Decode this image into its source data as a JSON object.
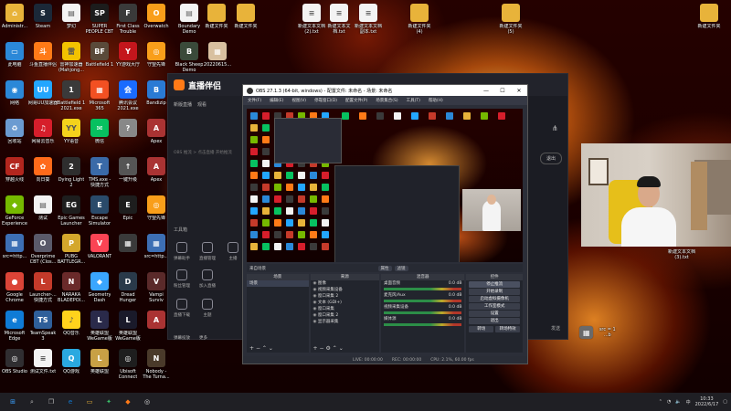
{
  "desktop": {
    "columns": [
      [
        {
          "label": "Administr...",
          "icon": "user-folder-icon",
          "color": "#e8b33a",
          "glyph": "⌂"
        },
        {
          "label": "此电脑",
          "icon": "this-pc-icon",
          "color": "#2b88d8",
          "glyph": "▭"
        },
        {
          "label": "网络",
          "icon": "network-icon",
          "color": "#2b88d8",
          "glyph": "◉"
        },
        {
          "label": "回收站",
          "icon": "recycle-bin-icon",
          "color": "#6b9bd1",
          "glyph": "♻"
        },
        {
          "label": "穿越火线",
          "icon": "crossfire-icon",
          "color": "#b3261e",
          "glyph": "CF"
        },
        {
          "label": "GeForce\nExperience",
          "icon": "geforce-icon",
          "color": "#76b900",
          "glyph": "◆"
        },
        {
          "label": "src=http...",
          "icon": "image-file-icon",
          "color": "#3d6fb4",
          "glyph": "▦"
        },
        {
          "label": "Google\nChrome",
          "icon": "chrome-icon",
          "color": "#db4437",
          "glyph": "●"
        },
        {
          "label": "Microsoft\nEdge",
          "icon": "edge-icon",
          "color": "#0f7bd6",
          "glyph": "e"
        },
        {
          "label": "OBS Studio",
          "icon": "obs-icon",
          "color": "#302e31",
          "glyph": "◎"
        }
      ],
      [
        {
          "label": "Steam",
          "icon": "steam-icon",
          "color": "#1b2838",
          "glyph": "S"
        },
        {
          "label": "斗鱼直播伴侣",
          "icon": "douyu-icon",
          "color": "#ff7a17",
          "glyph": "斗"
        },
        {
          "label": "网易UU加速器",
          "icon": "uu-booster-icon",
          "color": "#23a6ff",
          "glyph": "UU"
        },
        {
          "label": "网易云音乐",
          "icon": "netease-music-icon",
          "color": "#d61e2b",
          "glyph": "♫"
        },
        {
          "label": "向日葵",
          "icon": "sunlogin-icon",
          "color": "#ff6a1a",
          "glyph": "✿"
        },
        {
          "label": "测试",
          "icon": "test-file-icon",
          "color": "#f3f3f3",
          "glyph": "▤"
        },
        {
          "label": "Overprime\nCBT (Clos...",
          "icon": "overprime-icon",
          "color": "#5a5a6a",
          "glyph": "O"
        },
        {
          "label": "Launcher-...\n快捷方式",
          "icon": "launcher-icon",
          "color": "#c53a2a",
          "glyph": "L"
        },
        {
          "label": "TeamSpeak\n3",
          "icon": "teamspeak-icon",
          "color": "#2f5f9a",
          "glyph": "TS"
        },
        {
          "label": "测试文件.txt",
          "icon": "text-file-icon",
          "color": "#f3f3f3",
          "glyph": "≡"
        }
      ],
      [
        {
          "label": "梦幻",
          "icon": "file-icon",
          "color": "#f3f3f3",
          "glyph": "▤"
        },
        {
          "label": "雷神加速器\n(Mahjong...",
          "icon": "leishen-icon",
          "color": "#f2c200",
          "glyph": "雷"
        },
        {
          "label": "Battlefield 1\n2021.exe",
          "icon": "battlefield-icon",
          "color": "#3a3a3a",
          "glyph": "1"
        },
        {
          "label": "YY语音",
          "icon": "yy-icon",
          "color": "#f4d21c",
          "glyph": "YY"
        },
        {
          "label": "Dying Light\n2",
          "icon": "dying-light-icon",
          "color": "#2e2e2e",
          "glyph": "2"
        },
        {
          "label": "Epic Games\nLauncher",
          "icon": "epic-games-icon",
          "color": "#1e1e1e",
          "glyph": "EG"
        },
        {
          "label": "PUBG\nBATTLEGR...",
          "icon": "pubg-icon",
          "color": "#d4a72c",
          "glyph": "P"
        },
        {
          "label": "NARAKA\nBLADEPOI...",
          "icon": "naraka-icon",
          "color": "#6a2a2a",
          "glyph": "N"
        },
        {
          "label": "QQ音乐",
          "icon": "qq-music-icon",
          "color": "#ffd21c",
          "glyph": "♪"
        },
        {
          "label": "QQ游戏",
          "icon": "qq-game-icon",
          "color": "#2aa9e0",
          "glyph": "Q"
        }
      ],
      [
        {
          "label": "SUPER\nPEOPLE CBT",
          "icon": "super-people-icon",
          "color": "#1c1c1c",
          "glyph": "SP"
        },
        {
          "label": "Battlefield 1",
          "icon": "battlefield-1-icon",
          "color": "#5a4a3a",
          "glyph": "BF"
        },
        {
          "label": "Microsoft\n365",
          "icon": "microsoft-365-icon",
          "color": "#f25022",
          "glyph": "▦"
        },
        {
          "label": "微信",
          "icon": "wechat-icon",
          "color": "#07c160",
          "glyph": "✉"
        },
        {
          "label": "TMS.exe -\n快捷方式",
          "icon": "tms-icon",
          "color": "#3a6aa8",
          "glyph": "T"
        },
        {
          "label": "Escape\nSimulator",
          "icon": "escape-simulator-icon",
          "color": "#2a4a6a",
          "glyph": "E"
        },
        {
          "label": "VALORANT",
          "icon": "valorant-icon",
          "color": "#fa4454",
          "glyph": "V"
        },
        {
          "label": "Geometry\nDash",
          "icon": "geometry-dash-icon",
          "color": "#3aa6ff",
          "glyph": "◆"
        },
        {
          "label": "英雄联盟\nWeGame版",
          "icon": "lol-wegame-icon",
          "color": "#2a2a4a",
          "glyph": "L"
        },
        {
          "label": "英雄联盟",
          "icon": "lol-icon",
          "color": "#c8a045",
          "glyph": "L"
        }
      ],
      [
        {
          "label": "First Class\nTrouble",
          "icon": "first-class-trouble-icon",
          "color": "#3a3a3a",
          "glyph": "F"
        },
        {
          "label": "YY游戏大厅",
          "icon": "yy-game-icon",
          "color": "#c4161c",
          "glyph": "Y"
        },
        {
          "label": "腾讯会议\n2021.exe",
          "icon": "tencent-meeting-icon",
          "color": "#1a6bff",
          "glyph": "会"
        },
        {
          "label": "",
          "icon": "app-icon",
          "color": "#888888",
          "glyph": "?"
        },
        {
          "label": "一键升级",
          "icon": "app-icon",
          "color": "#555555",
          "glyph": "↑"
        },
        {
          "label": "Epic",
          "icon": "app-icon",
          "color": "#1e1e1e",
          "glyph": "E"
        },
        {
          "label": "",
          "icon": "app-icon",
          "color": "#3a3a3a",
          "glyph": "▦"
        },
        {
          "label": "Dread\nHunger",
          "icon": "dread-hunger-icon",
          "color": "#2a3a4a",
          "glyph": "D"
        },
        {
          "label": "英雄联盟\nWeGame版",
          "icon": "lol-wegame-icon-2",
          "color": "#1a1a2a",
          "glyph": "L"
        },
        {
          "label": "Ubisoft\nConnect",
          "icon": "ubisoft-icon",
          "color": "#1e1e1e",
          "glyph": "◎"
        }
      ],
      [
        {
          "label": "Overwatch",
          "icon": "overwatch-icon",
          "color": "#f99e1a",
          "glyph": "O"
        },
        {
          "label": "守望先锋",
          "icon": "overwatch-cn-icon",
          "color": "#f99e1a",
          "glyph": "◎"
        },
        {
          "label": "Bandizip",
          "icon": "bandizip-icon",
          "color": "#2a7ad4",
          "glyph": "B"
        },
        {
          "label": "Apex",
          "icon": "apex-icon",
          "color": "#a33",
          "glyph": "A"
        },
        {
          "label": "Apex",
          "icon": "apex-icon-2",
          "color": "#a33",
          "glyph": "A"
        },
        {
          "label": "守望先锋",
          "icon": "overwatch-cn-icon-2",
          "color": "#f99e1a",
          "glyph": "◎"
        },
        {
          "label": "src=http...",
          "icon": "image-file-icon-2",
          "color": "#3d6fb4",
          "glyph": "▦"
        },
        {
          "label": "Vampi\nSurviv",
          "icon": "vampire-survivors-icon",
          "color": "#5a2a2a",
          "glyph": "V"
        },
        {
          "label": "",
          "icon": "app-icon",
          "color": "#a33",
          "glyph": "A"
        },
        {
          "label": "Nobody -\nThe Turna...",
          "icon": "nobody-icon",
          "color": "#4a3a2a",
          "glyph": "N"
        }
      ]
    ],
    "top_items": [
      {
        "label": "Boundary\nDemo",
        "icon": "boundary-demo-icon",
        "color": "#f3f3f3",
        "glyph": "▤"
      },
      {
        "label": "新建文件夹",
        "icon": "folder-icon",
        "color": "#e8b33a",
        "glyph": ""
      },
      {
        "label": "新建文件夹",
        "icon": "folder-icon",
        "color": "#e8b33a",
        "glyph": ""
      },
      {
        "label": "新建文本文档\n(2).txt",
        "icon": "text-file-icon",
        "color": "#f3f3f3",
        "glyph": "≡"
      },
      {
        "label": "新建文本文\n档.txt",
        "icon": "text-file-icon",
        "color": "#f3f3f3",
        "glyph": "≡"
      },
      {
        "label": "新建文本文档\n副本.txt",
        "icon": "text-file-icon",
        "color": "#f3f3f3",
        "glyph": "≡"
      },
      {
        "label": "新建文件夹\n(4)",
        "icon": "folder-icon",
        "color": "#e8b33a",
        "glyph": ""
      },
      {
        "label": "新建文件夹\n(5)",
        "icon": "folder-icon",
        "color": "#e8b33a",
        "glyph": ""
      },
      {
        "label": "新建文件夹",
        "icon": "folder-icon",
        "color": "#e8b33a",
        "glyph": ""
      }
    ],
    "row2_items": [
      {
        "label": "Black Sheep\nDemo",
        "icon": "black-sheep-icon",
        "color": "#3a4a3a",
        "glyph": "B"
      },
      {
        "label": "20220615...",
        "icon": "image-file-icon-3",
        "color": "#d8c0a0",
        "glyph": "▦"
      }
    ],
    "bottom_right": [
      {
        "label": "新建文本文档\n(3).txt",
        "icon": "text-file-icon",
        "color": "#f3f3f3",
        "glyph": "≡"
      },
      {
        "label": "src = 1  ...b",
        "icon": "image-file-icon-4",
        "color": "#6a6a6a",
        "glyph": "▦"
      }
    ]
  },
  "livestream_app": {
    "brand": "直播伴侣",
    "tabs": [
      "新版直播",
      "观看"
    ],
    "placeholder": "OBS 推流 > 点击直播 开始推流",
    "tools_title": "工具箱",
    "tools": [
      {
        "label": "弹幕助手",
        "icon": "danmaku-icon"
      },
      {
        "label": "直播管理",
        "icon": "manage-icon"
      },
      {
        "label": "主播",
        "icon": "anchor-icon"
      },
      {
        "label": "粉丝管理",
        "icon": "fans-icon"
      },
      {
        "label": "加入直播",
        "icon": "join-icon"
      },
      {
        "label": "直播下载",
        "icon": "download-icon"
      },
      {
        "label": "主题",
        "icon": "theme-icon"
      }
    ],
    "bottom_links": [
      "弹幕投放",
      "更多"
    ],
    "exit": "退出",
    "send": "发送"
  },
  "obs": {
    "title": "OBS 27.1.3 (64-bit, windows) - 配置文件: 未命名 - 场景: 未命名",
    "menu": [
      "文件(F)",
      "编辑(E)",
      "视图(V)",
      "停靠窗口(D)",
      "配置文件(P)",
      "场景集合(S)",
      "工具(T)",
      "帮助(H)"
    ],
    "scene_bar_left": "来自场景",
    "scene_bar_buttons": [
      "属性",
      "滤镜"
    ],
    "docks": {
      "scenes_title": "场景",
      "scenes": [
        "场景"
      ],
      "sources_title": "来源",
      "sources": [
        "图像",
        "视频采集设备",
        "窗口采集 2",
        "文本 (GDI+)",
        "窗口采集",
        "窗口采集 2",
        "显示器采集"
      ],
      "mixer_title": "混音器",
      "mixer_tracks": [
        "桌面音频",
        "麦克风/Aux",
        "视频采集设备",
        "媒体源"
      ],
      "mixer_levels": [
        "0.0 dB",
        "0.0 dB",
        "0.0 dB",
        "0.0 dB"
      ],
      "controls_title": "控件",
      "controls": [
        "停止推流",
        "开始录制",
        "启动虚拟摄像机",
        "工作室模式",
        "设置",
        "退出"
      ],
      "controls_bottom": [
        "转场",
        "转场特效"
      ]
    },
    "status": [
      "LIVE: 00:00:00",
      "REC: 00:00:00",
      "CPU: 2.1%, 60.00 fps"
    ]
  },
  "webcam": {
    "label": "新建文本文档\n(3).txt"
  },
  "taskbar": {
    "time": "10:33",
    "date": "2022/6/17",
    "apps": [
      {
        "name": "start",
        "glyph": "⊞",
        "color": "#3aa0ff"
      },
      {
        "name": "search",
        "glyph": "⌕",
        "color": "#bbbbbb"
      },
      {
        "name": "task-view",
        "glyph": "❐",
        "color": "#bbbbbb"
      },
      {
        "name": "edge",
        "glyph": "e",
        "color": "#0f7bd6"
      },
      {
        "name": "file-explorer",
        "glyph": "▭",
        "color": "#e8b33a"
      },
      {
        "name": "app-green",
        "glyph": "✦",
        "color": "#3ac06a"
      },
      {
        "name": "app-orange",
        "glyph": "◆",
        "color": "#ff7a17"
      },
      {
        "name": "obs",
        "glyph": "◎",
        "color": "#dddddd"
      }
    ]
  }
}
